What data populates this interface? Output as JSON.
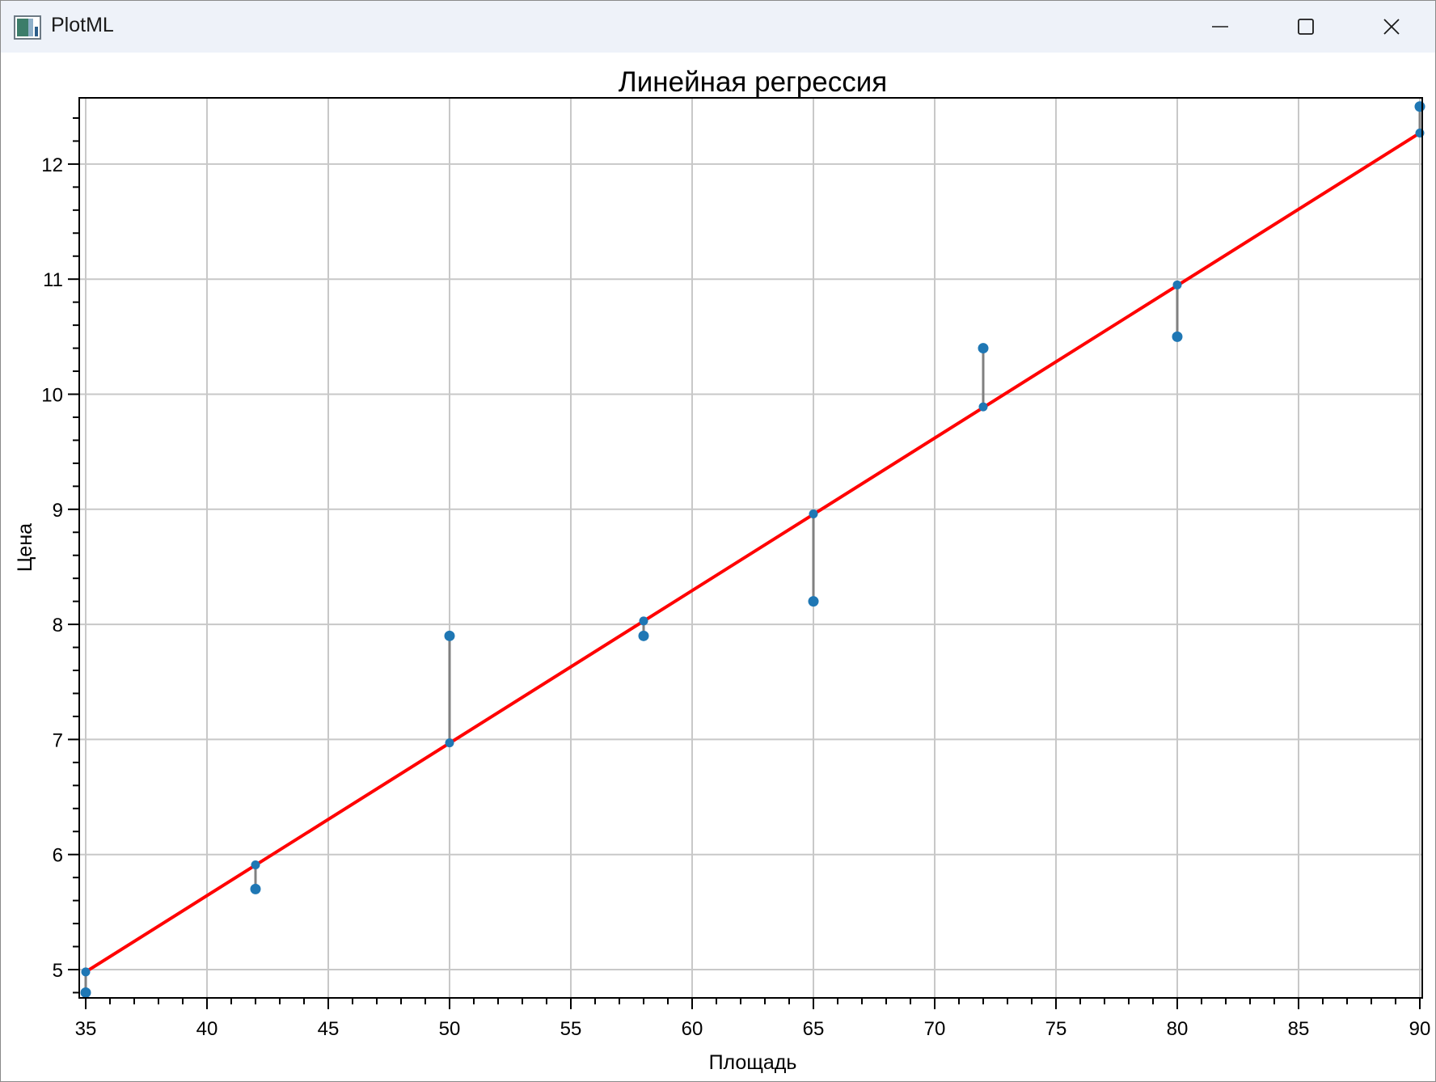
{
  "window": {
    "title": "PlotML"
  },
  "chart_data": {
    "type": "scatter",
    "title": "Линейная регрессия",
    "xlabel": "Площадь",
    "ylabel": "Цена",
    "xlim": [
      35,
      90
    ],
    "ylim": [
      4.75,
      12.55
    ],
    "xticks": [
      35,
      40,
      45,
      50,
      55,
      60,
      65,
      70,
      75,
      80,
      85,
      90
    ],
    "yticks": [
      5,
      6,
      7,
      8,
      9,
      10,
      11,
      12
    ],
    "grid": true,
    "regression_line": {
      "x": [
        35,
        90
      ],
      "y": [
        4.98,
        12.27
      ],
      "color": "#ff0000"
    },
    "points_actual": {
      "x": [
        35,
        42,
        50,
        58,
        65,
        72,
        80,
        90
      ],
      "y": [
        4.8,
        5.7,
        7.9,
        7.9,
        8.2,
        10.4,
        10.5,
        12.5
      ]
    },
    "points_predicted": {
      "x": [
        35,
        42,
        50,
        58,
        65,
        72,
        80,
        90
      ],
      "y": [
        4.98,
        5.91,
        6.97,
        8.03,
        8.96,
        9.89,
        10.95,
        12.27
      ]
    },
    "colors": {
      "points": "#1f77b4",
      "residuals": "#808080",
      "grid": "#c8c8c8"
    }
  }
}
